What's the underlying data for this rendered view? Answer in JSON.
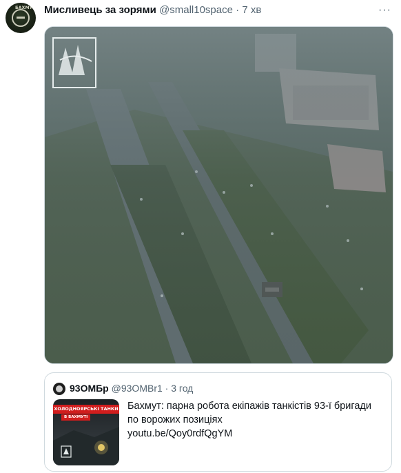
{
  "tweet": {
    "author_name": "Мисливець за зорями",
    "handle": "@small10space",
    "separator": "·",
    "time": "7 хв",
    "more_label": "···",
    "avatar_label": "БАХМУТ"
  },
  "quote": {
    "author_name": "93ОМБр",
    "handle": "@93OMBr1",
    "separator": "·",
    "time": "3 год",
    "text": "Бахмут: парна робота екіпажів танкістів 93-ї бригади по ворожих позиціях",
    "link": "youtu.be/Qoy0rdfQgYM",
    "thumb_banner": "ХОЛОДНОЯРСЬКІ ТАНКИ",
    "thumb_sub": "В БАХМУТІ"
  },
  "colors": {
    "text_primary": "#0f1419",
    "text_secondary": "#536471",
    "border": "#cfd9de",
    "banner_red": "#d11d1d"
  }
}
